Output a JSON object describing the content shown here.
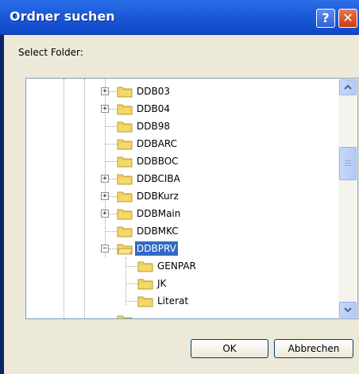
{
  "dialog": {
    "title": "Ordner suchen",
    "help_label": "?",
    "close_label": "✕",
    "prompt": "Select Folder:"
  },
  "tree": {
    "items": [
      {
        "label": "DDB03",
        "expander": "+"
      },
      {
        "label": "DDB04",
        "expander": "+"
      },
      {
        "label": "DDB98",
        "expander": ""
      },
      {
        "label": "DDBARC",
        "expander": ""
      },
      {
        "label": "DDBBOC",
        "expander": ""
      },
      {
        "label": "DDBCIBA",
        "expander": "+"
      },
      {
        "label": "DDBKurz",
        "expander": "+"
      },
      {
        "label": "DDBMain",
        "expander": "+"
      },
      {
        "label": "DDBMKC",
        "expander": ""
      },
      {
        "label": "DDBPRV",
        "expander": "−",
        "selected": true
      },
      {
        "label": "GENPAR",
        "expander": ""
      },
      {
        "label": "JK",
        "expander": ""
      },
      {
        "label": "Literat",
        "expander": ""
      }
    ]
  },
  "scrollbar": {
    "up_icon": "▲",
    "down_icon": "▼"
  },
  "buttons": {
    "ok": "OK",
    "cancel": "Abbrechen"
  },
  "colors": {
    "titlebar": "#1c5ad8",
    "selection": "#316ac5",
    "dialog_bg": "#ece9d8"
  }
}
